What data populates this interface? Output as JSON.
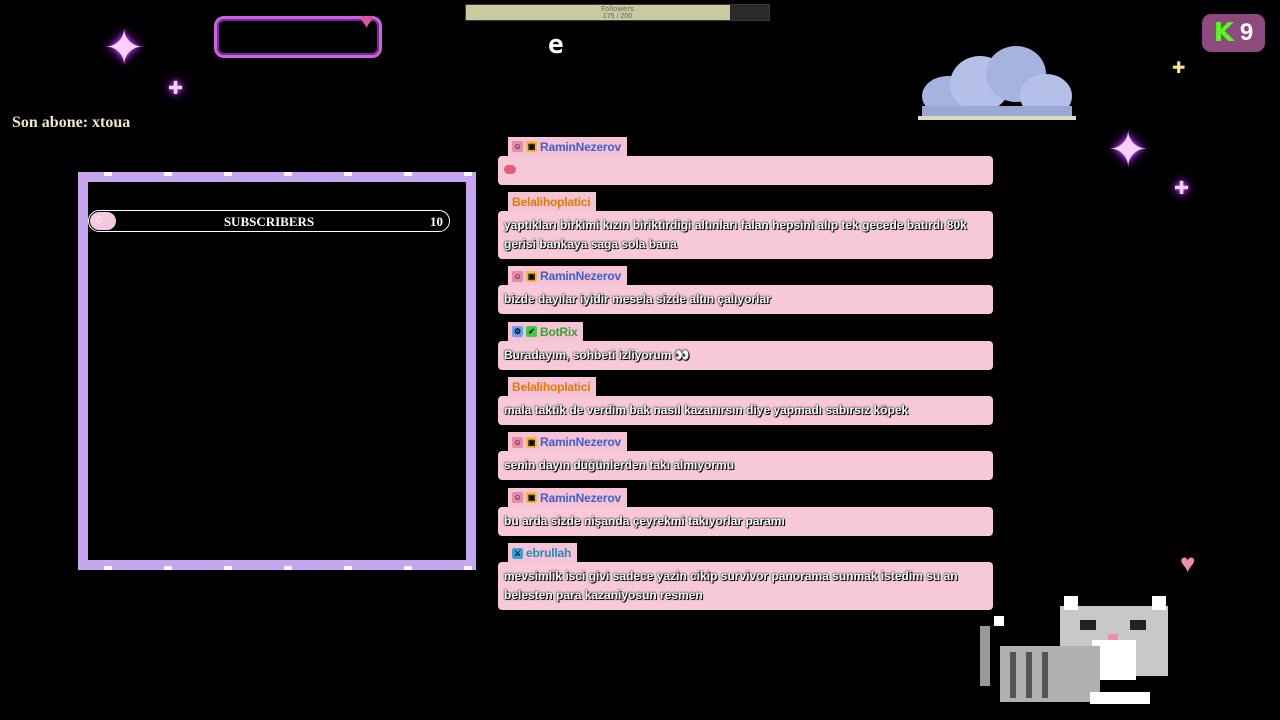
{
  "overlay": {
    "follower_bar": {
      "label": "Followers",
      "count": "175 / 200",
      "progress": 0.87
    },
    "last_sub": "Son abone: xtoua",
    "sub_goal": {
      "label": "SUBSCRIBERS",
      "current": "0",
      "target": "10"
    },
    "kick": {
      "icon": "kick-logo-icon",
      "viewers": "9"
    },
    "colors": {
      "bubble": "#f7c8d8",
      "panel_border": "#c6a6f0",
      "kick_green": "#53fc18"
    }
  },
  "chat": {
    "messages": [
      {
        "user": "RaminNezerov",
        "user_color": "#4060c8",
        "badges": [
          "sub-icon",
          "gift-icon"
        ],
        "text": "",
        "emote": "emote-icon"
      },
      {
        "user": "Belalihoplatici",
        "user_color": "#e07a00",
        "badges": [],
        "text": "yaptıkları birkimi kızın biriktirdigi altınları falan hepsini alıp tek gecede batırdı 80k gerisi bankaya saga sola bana"
      },
      {
        "user": "RaminNezerov",
        "user_color": "#4060c8",
        "badges": [
          "sub-icon",
          "gift-icon"
        ],
        "text": "bizde dayılar iyidir mesela sizde altın çalıyorlar"
      },
      {
        "user": "BotRix",
        "user_color": "#2fa82f",
        "badges": [
          "bot-icon",
          "verified-icon"
        ],
        "text": "Buradayım, sohbeti izliyorum 👀"
      },
      {
        "user": "Belalihoplatici",
        "user_color": "#e07a00",
        "badges": [],
        "text": "mala taktik de verdim bak nasıl kazanırsın diye yapmadı sabırsız köpek"
      },
      {
        "user": "RaminNezerov",
        "user_color": "#4060c8",
        "badges": [
          "sub-icon",
          "gift-icon"
        ],
        "text": "senin dayın düğünlerden takı almıyormu"
      },
      {
        "user": "RaminNezerov",
        "user_color": "#4060c8",
        "badges": [
          "sub-icon",
          "gift-icon"
        ],
        "text": "bu arda sizde nişanda çeyrekmi takıyorlar paramı"
      },
      {
        "user": "ebrullah",
        "user_color": "#1f8fb0",
        "badges": [
          "moderator-icon"
        ],
        "text": "mevsimlik isci givi sadece yazin cikip survivor panorama sunmak istedim su an belesten para kazaniyosun resmen"
      }
    ]
  }
}
